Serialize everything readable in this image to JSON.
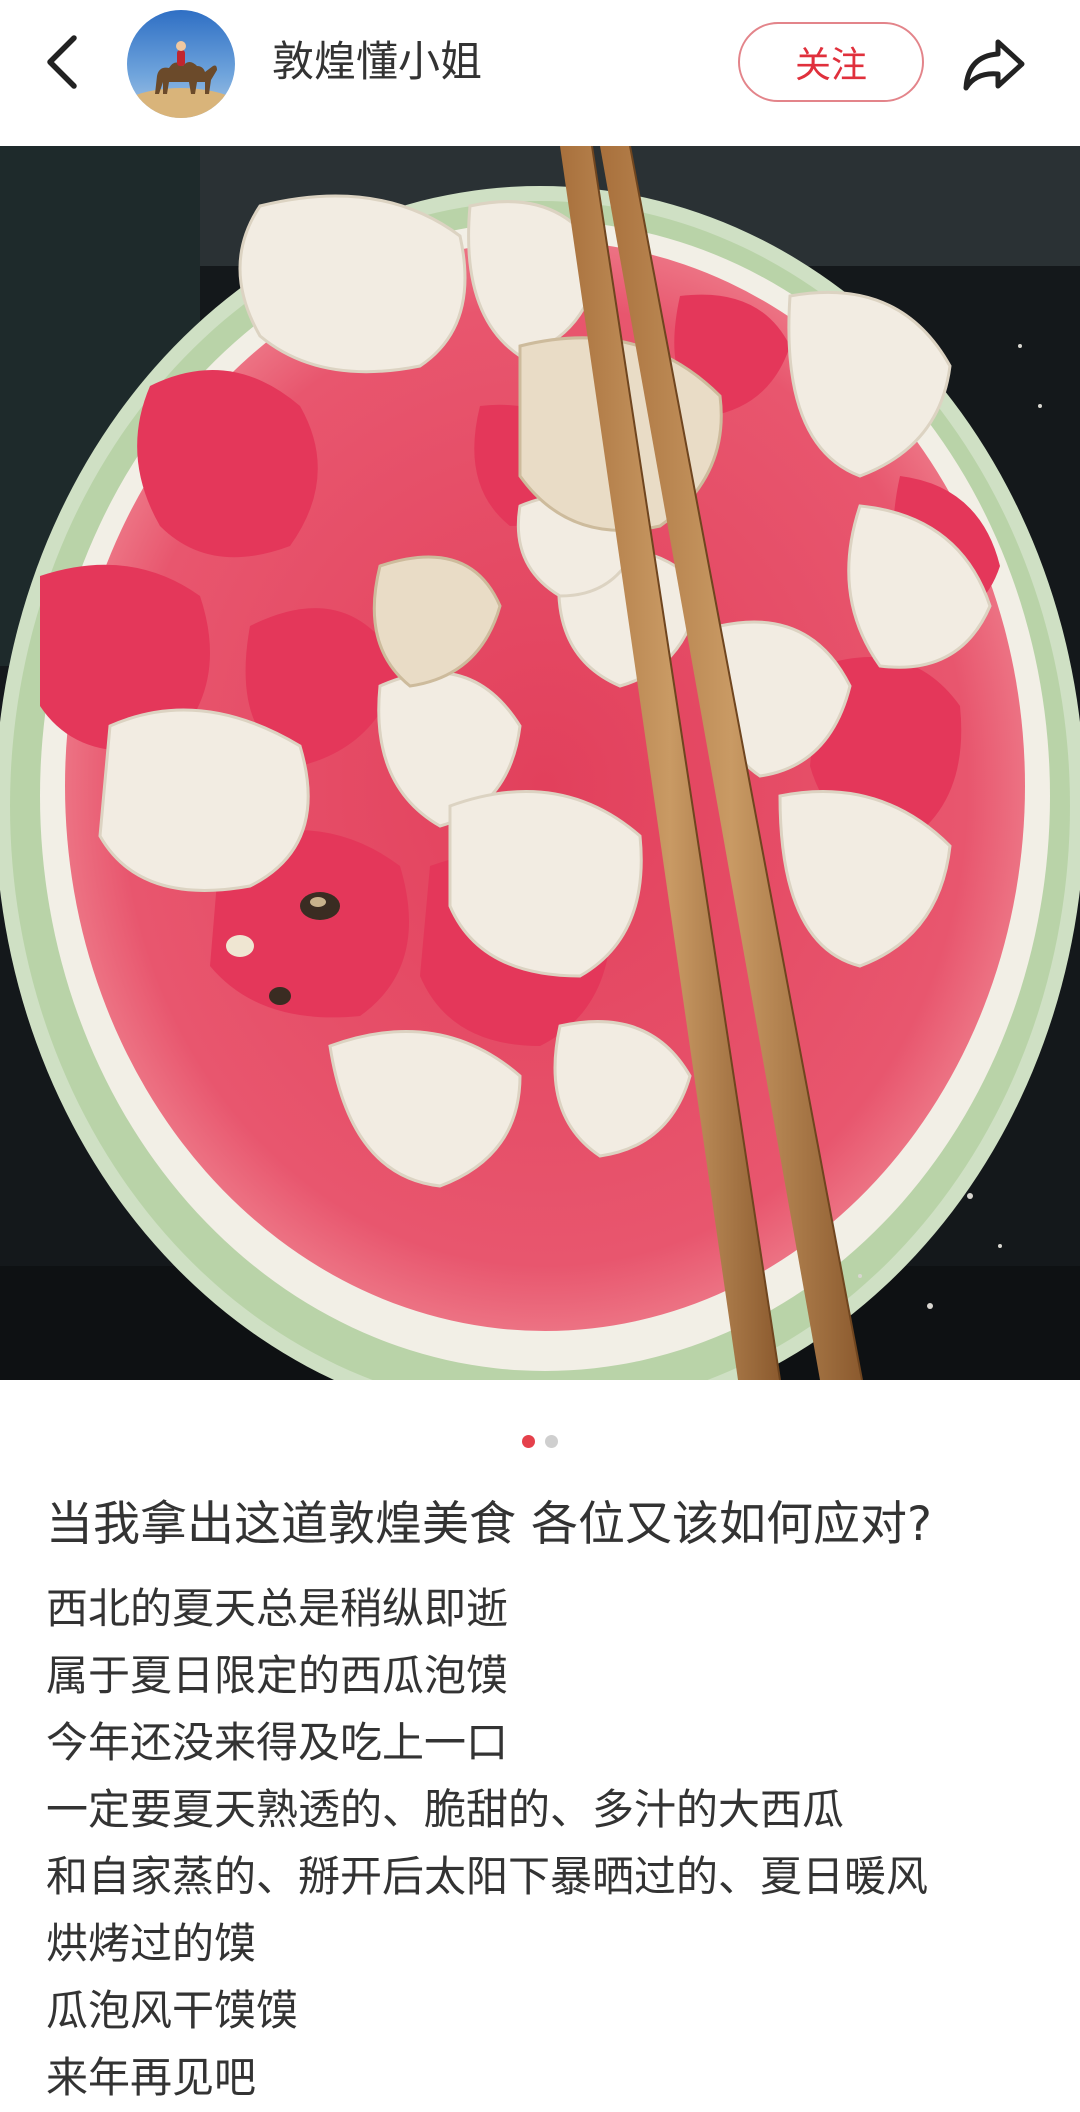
{
  "header": {
    "back_icon": "chevron-left-icon",
    "author_name": "敦煌懂小姐",
    "avatar_alt": "camel-avatar",
    "follow_label": "关注",
    "share_icon": "share-arrow-icon",
    "accent_color": "#e0303c"
  },
  "media": {
    "image_subject": "watermelon-bread-in-rind-with-chopsticks",
    "carousel": {
      "total": 2,
      "active_index": 0
    }
  },
  "post": {
    "title": "当我拿出这道敦煌美食 各位又该如何应对?",
    "lines": [
      "西北的夏天总是稍纵即逝",
      "属于夏日限定的西瓜泡馍",
      "今年还没来得及吃上一口",
      "一定要夏天熟透的、脆甜的、多汁的大西瓜",
      "和自家蒸的、掰开后太阳下暴晒过的、夏日暖风",
      "烘烤过的馍",
      "瓜泡风干馍馍",
      "来年再见吧"
    ]
  }
}
